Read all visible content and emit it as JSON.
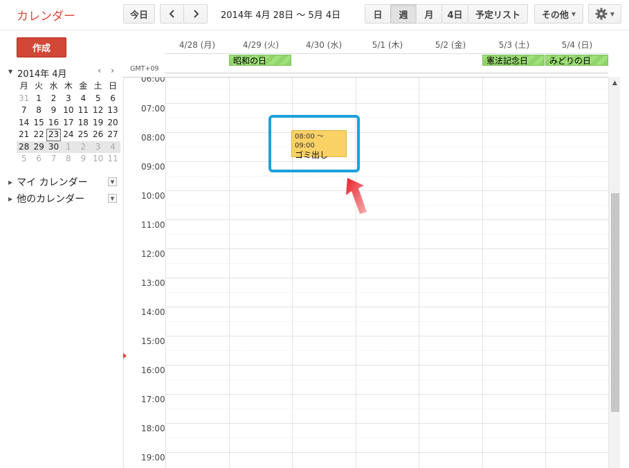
{
  "header": {
    "logo": "カレンダー",
    "today": "今日",
    "prev_icon": "chevron-left-icon",
    "next_icon": "chevron-right-icon",
    "date_range": "2014年 4月 28日 ～ 5月 4日",
    "views": [
      "日",
      "週",
      "月",
      "4日",
      "予定リスト"
    ],
    "selected_view": "週",
    "more": "その他",
    "settings_icon": "gear-icon"
  },
  "sidebar": {
    "create": "作成",
    "mini_calendar": {
      "title": "2014年 4月",
      "weekdays": [
        "月",
        "火",
        "水",
        "木",
        "金",
        "土",
        "日"
      ],
      "weeks": [
        [
          "31",
          "1",
          "2",
          "3",
          "4",
          "5",
          "6"
        ],
        [
          "7",
          "8",
          "9",
          "10",
          "11",
          "12",
          "13"
        ],
        [
          "14",
          "15",
          "16",
          "17",
          "18",
          "19",
          "20"
        ],
        [
          "21",
          "22",
          "23",
          "24",
          "25",
          "26",
          "27"
        ],
        [
          "28",
          "29",
          "30",
          "1",
          "2",
          "3",
          "4"
        ],
        [
          "5",
          "6",
          "7",
          "8",
          "9",
          "10",
          "11"
        ]
      ],
      "today": "23"
    },
    "my_calendars": "マイ カレンダー",
    "other_calendars": "他のカレンダー"
  },
  "week": {
    "days": [
      "4/28 (月)",
      "4/29 (火)",
      "4/30 (水)",
      "5/1 (木)",
      "5/2 (金)",
      "5/3 (土)",
      "5/4 (日)"
    ],
    "timezone": "GMT+09",
    "holidays": [
      {
        "day_index": 1,
        "label": "昭和の日"
      },
      {
        "day_index": 5,
        "label": "憲法記念日"
      },
      {
        "day_index": 6,
        "label": "みどりの日"
      }
    ],
    "hours": [
      "06:00",
      "07:00",
      "08:00",
      "09:00",
      "10:00",
      "11:00",
      "12:00",
      "13:00",
      "14:00",
      "15:00",
      "16:00",
      "17:00",
      "18:00",
      "19:00"
    ],
    "event": {
      "day_index": 2,
      "time": "08:00 ～ 09:00",
      "title": "ゴミ出し",
      "color": "#fad165"
    },
    "accent_highlight": "#1ba1dc",
    "pointer_arrow_color": "#d23a3a"
  }
}
